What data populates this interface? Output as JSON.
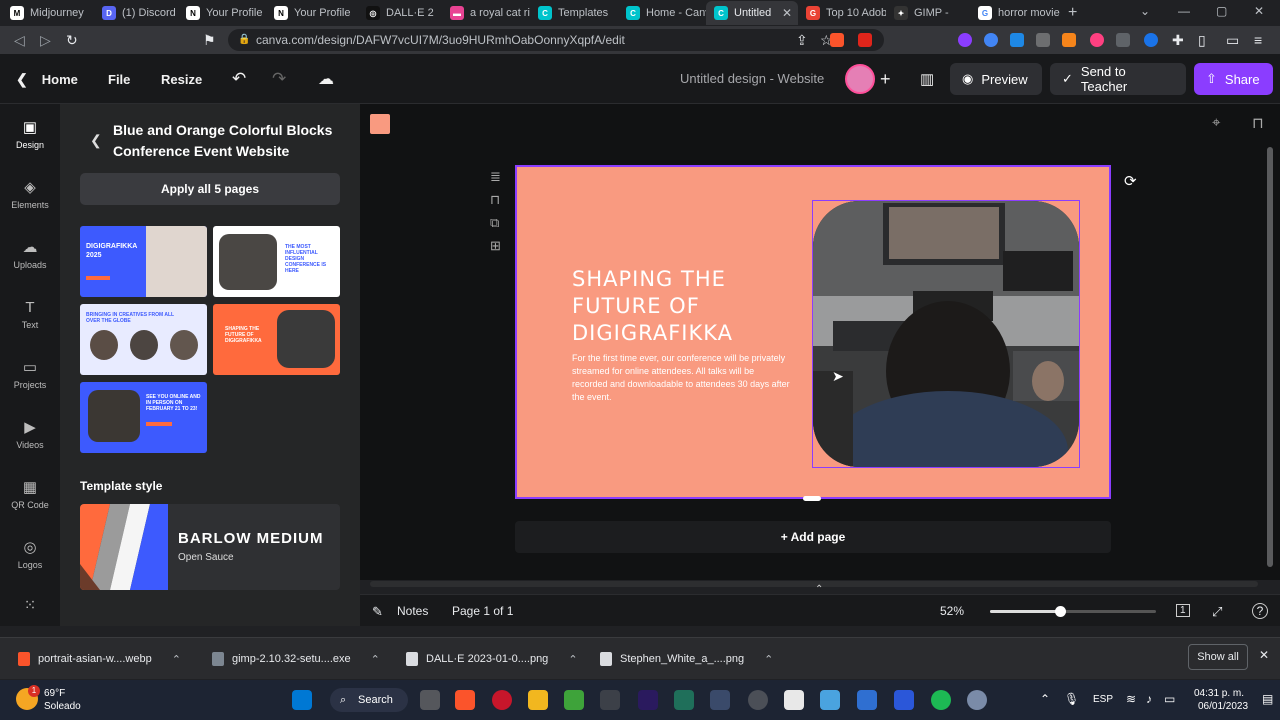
{
  "browser": {
    "tabs": [
      {
        "label": "Midjourney",
        "color": "#ffffff",
        "fg": "#000000",
        "glyph": "M"
      },
      {
        "label": "(1) Discord |",
        "color": "#5865f2",
        "fg": "#ffffff",
        "glyph": "D"
      },
      {
        "label": "Your Profile",
        "color": "#ffffff",
        "fg": "#000000",
        "glyph": "N"
      },
      {
        "label": "Your Profile",
        "color": "#ffffff",
        "fg": "#000000",
        "glyph": "N"
      },
      {
        "label": "DALL·E 2",
        "color": "#111111",
        "fg": "#ffffff",
        "glyph": "◎"
      },
      {
        "label": "a royal cat ri",
        "color": "#e84393",
        "fg": "#ffffff",
        "glyph": "▬"
      },
      {
        "label": "Templates",
        "color": "#00c4cc",
        "fg": "#ffffff",
        "glyph": "C"
      },
      {
        "label": "Home - Canv",
        "color": "#00c4cc",
        "fg": "#ffffff",
        "glyph": "C"
      },
      {
        "label": "Untitled",
        "color": "#00c4cc",
        "fg": "#ffffff",
        "glyph": "C"
      },
      {
        "label": "Top 10 Adob",
        "color": "#ea4335",
        "fg": "#ffffff",
        "glyph": "G"
      },
      {
        "label": "GIMP - ",
        "color": "#333333",
        "fg": "#ffffff",
        "glyph": "✦"
      },
      {
        "label": "horror movie",
        "color": "#ffffff",
        "fg": "#4285f4",
        "glyph": "G"
      }
    ],
    "tab_close": "✕",
    "new_tab": "+",
    "url": "canva.com/design/DAFW7vcUI7M/3uo9HURmhOabOonnyXqpfA/edit"
  },
  "header": {
    "home": "Home",
    "file": "File",
    "resize": "Resize",
    "design_title": "Untitled design - Website",
    "add": "+",
    "preview": "Preview",
    "send": "Send to Teacher",
    "share": "Share"
  },
  "rail": [
    {
      "label": "Design",
      "icon": "▣",
      "name": "design"
    },
    {
      "label": "Elements",
      "icon": "◈",
      "name": "elements"
    },
    {
      "label": "Uploads",
      "icon": "☁",
      "name": "uploads"
    },
    {
      "label": "Text",
      "icon": "T",
      "name": "text"
    },
    {
      "label": "Projects",
      "icon": "▭",
      "name": "projects"
    },
    {
      "label": "Videos",
      "icon": "▶",
      "name": "videos"
    },
    {
      "label": "QR Code",
      "icon": "▦",
      "name": "qr-code"
    },
    {
      "label": "Logos",
      "icon": "◎",
      "name": "logos"
    }
  ],
  "panel": {
    "title": "Blue and Orange Colorful Blocks Conference Event Website",
    "apply": "Apply all 5 pages",
    "thumbs": [
      {
        "bg": "#3d5afe",
        "text": "DIGIGRAFIKKA 2025",
        "fg": "#ffffff"
      },
      {
        "bg": "#ffffff",
        "text": "THE MOST INFLUENTIAL DESIGN CONFERENCE IS HERE",
        "fg": "#3d5afe"
      },
      {
        "bg": "#e8ebff",
        "text": "BRINGING IN CREATIVES FROM ALL OVER THE GLOBE",
        "fg": "#3d5afe"
      },
      {
        "bg": "#ff6a3d",
        "text": "SHAPING THE FUTURE OF DIGIGRAFIKKA",
        "fg": "#ffffff"
      },
      {
        "bg": "#3d5afe",
        "text": "SEE YOU ONLINE AND IN PERSON ON FEBRUARY 21 TO 23!",
        "fg": "#ffffff"
      }
    ],
    "style_label": "Template style",
    "style_font": "BARLOW MEDIUM",
    "style_sub": "Open Sauce"
  },
  "canvas": {
    "bg_color": "#f99a80",
    "title": "SHAPING THE FUTURE OF DIGIGRAFIKKA",
    "body": "For the first time ever, our conference will be privately streamed for online attendees. All talks will be recorded and downloadable to attendees 30 days after the event.",
    "add_page": "+ Add page"
  },
  "footer": {
    "notes": "Notes",
    "page": "Page 1 of 1",
    "zoom": "52%",
    "zoom_level": 0.42,
    "page_count_badge": "1"
  },
  "downloads": {
    "items": [
      "portrait-asian-w....webp",
      "gimp-2.10.32-setu....exe",
      "DALL·E 2023-01-0....png",
      "Stephen_White_a_....png"
    ],
    "show_all": "Show all",
    "close": "✕"
  },
  "taskbar": {
    "temp": "69°F",
    "weather": "Soleado",
    "badge": "1",
    "search": "Search",
    "lang": "ESP",
    "time": "04:31 p. m.",
    "date": "06/01/2023"
  }
}
